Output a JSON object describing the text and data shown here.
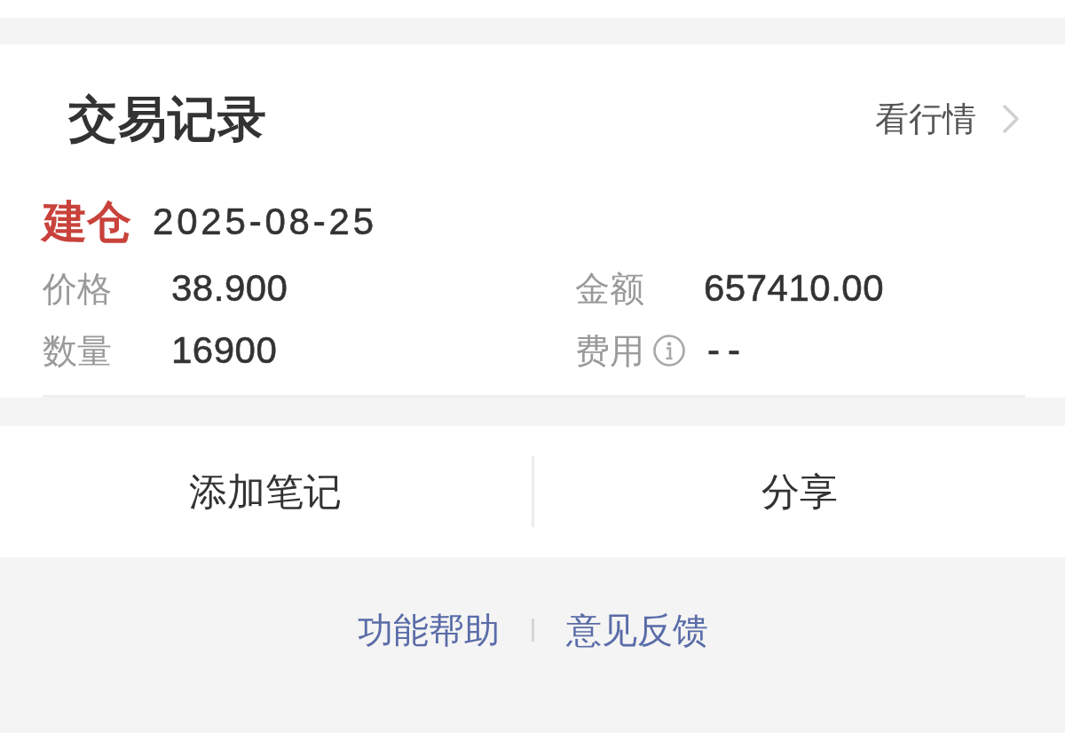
{
  "header": {
    "title": "交易记录",
    "link": "看行情"
  },
  "trade": {
    "type": {
      "label": "建仓",
      "kind": "buy"
    },
    "date": "2025-08-25",
    "fields": [
      {
        "label": "价格",
        "value": "38.900",
        "info": false
      },
      {
        "label": "金额",
        "value": "657410.00",
        "info": false
      },
      {
        "label": "数量",
        "value": "16900",
        "info": false
      },
      {
        "label": "费用",
        "value": "--",
        "info": true
      }
    ]
  },
  "actions": [
    "添加笔记",
    "分享"
  ],
  "footer_links": [
    "功能帮助",
    "意见反馈"
  ]
}
